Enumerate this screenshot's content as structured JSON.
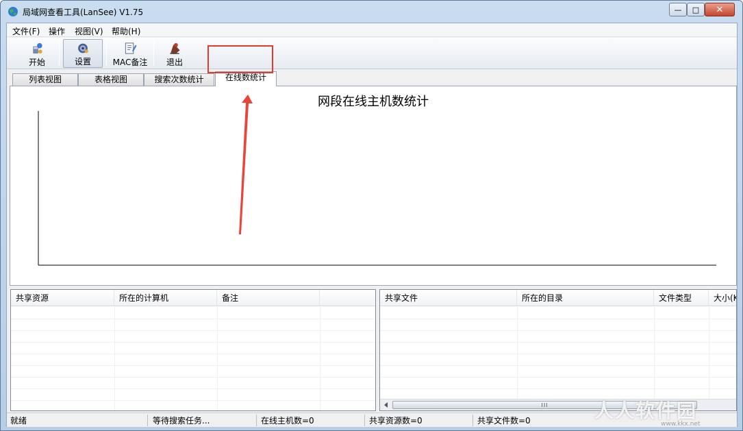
{
  "window": {
    "title": "局域网查看工具(LanSee) V1.75",
    "min_glyph": "—",
    "max_glyph": "□",
    "close_glyph": "✕"
  },
  "menu": [
    "文件(F)",
    "操作",
    "视图(V)",
    "帮助(H)"
  ],
  "toolbar": [
    {
      "label": "开始",
      "icon": "start-icon"
    },
    {
      "label": "设置",
      "icon": "gear-icon"
    },
    {
      "label": "MAC备注",
      "icon": "note-icon"
    },
    {
      "label": "退出",
      "icon": "exit-icon"
    }
  ],
  "tabs": [
    "列表视图",
    "表格视图",
    "搜索次数统计",
    "在线数统计"
  ],
  "active_tab": "在线数统计",
  "chart": {
    "title": "网段在线主机数统计"
  },
  "chart_data": {
    "type": "bar",
    "title": "网段在线主机数统计",
    "categories": [],
    "values": [],
    "xlabel": "",
    "ylabel": ""
  },
  "left_list": {
    "columns": [
      "共享资源",
      "所在的计算机",
      "备注",
      ""
    ]
  },
  "right_list": {
    "columns": [
      "共享文件",
      "所在的目录",
      "文件类型",
      "大小(K"
    ],
    "scroll_grip": "III"
  },
  "status": [
    "就绪",
    "等待搜索任务...",
    "在线主机数=0",
    "共享资源数=0",
    "共享文件数=0"
  ],
  "watermark": {
    "text": "人人软件园",
    "sub": "www.kkx.net"
  },
  "colors": {
    "highlight": "#e23b2e",
    "arrow": "#e8463a"
  }
}
